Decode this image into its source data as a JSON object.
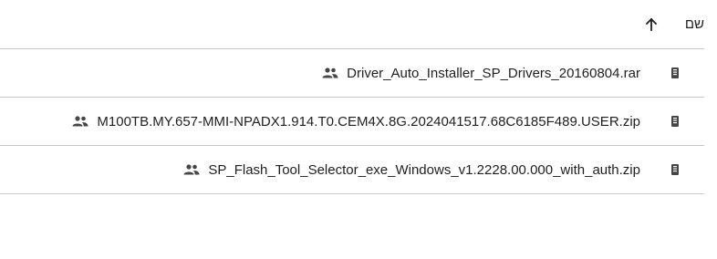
{
  "header": {
    "name_label": "שם",
    "sort_icon": "arrow-up-icon"
  },
  "files": [
    {
      "name": "Driver_Auto_Installer_SP_Drivers_20160804.rar",
      "shared": true,
      "type_icon": "archive-file-icon"
    },
    {
      "name": "M100TB.MY.657-MMI-NPADX1.914.T0.CEM4X.8G.2024041517.68C6185F489.USER.zip",
      "shared": true,
      "type_icon": "archive-file-icon"
    },
    {
      "name": "SP_Flash_Tool_Selector_exe_Windows_v1.2228.00.000_with_auth.zip",
      "shared": true,
      "type_icon": "archive-file-icon"
    }
  ],
  "colors": {
    "text": "#1f1f1f",
    "divider": "#c7c7c7",
    "icon": "#444746"
  }
}
